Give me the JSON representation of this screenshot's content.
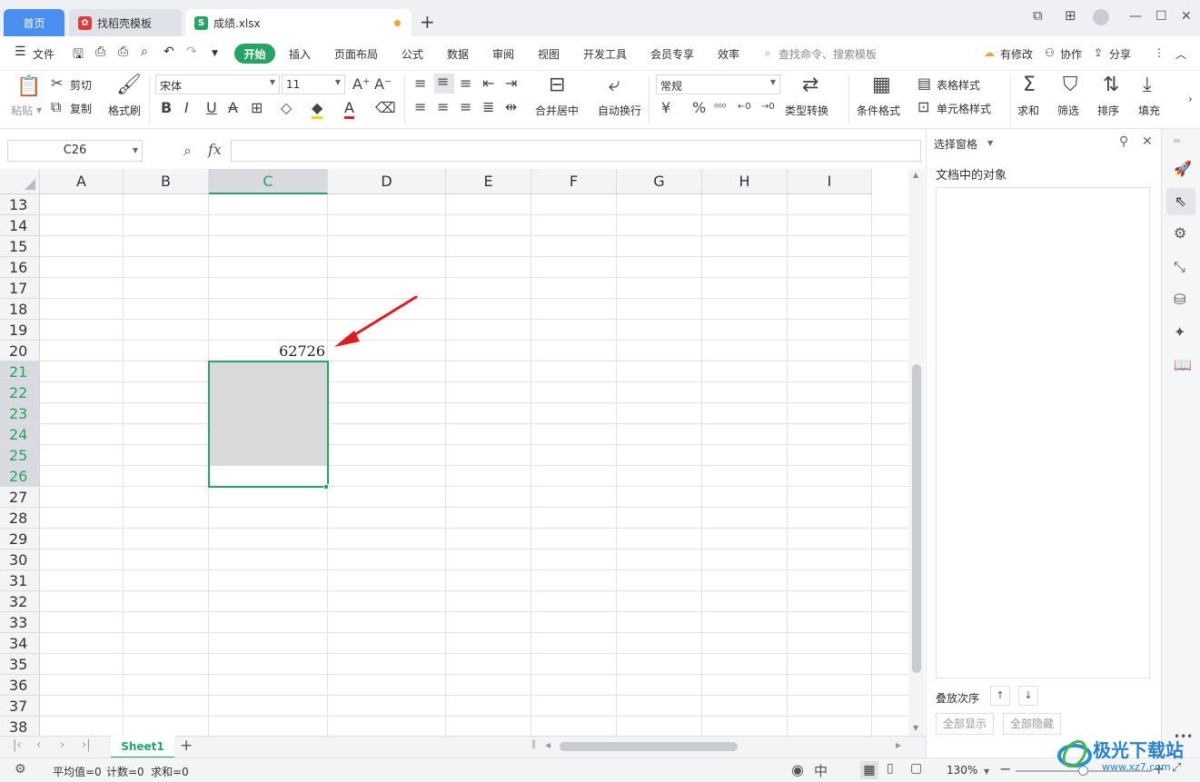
{
  "titlebar": {
    "tab_home": "首页",
    "tab_template": "找稻壳模板",
    "tab_file": "成绩.xlsx",
    "new_tab": "+"
  },
  "menu": {
    "file": "文件",
    "items": [
      "开始",
      "插入",
      "页面布局",
      "公式",
      "数据",
      "审阅",
      "视图",
      "开发工具",
      "会员专享",
      "效率"
    ],
    "search_placeholder": "查找命令、搜索模板",
    "modified": "有修改",
    "collaborate": "协作",
    "share": "分享"
  },
  "ribbon": {
    "paste": "粘贴",
    "cut": "剪切",
    "copy": "复制",
    "format_painter": "格式刷",
    "font_name": "宋体",
    "font_size": "11",
    "merge_center": "合并居中",
    "auto_wrap": "自动换行",
    "number_format": "常规",
    "type_convert": "类型转换",
    "conditional_format": "条件格式",
    "table_style": "表格样式",
    "cell_style": "单元格样式",
    "sum": "求和",
    "filter": "筛选",
    "sort": "排序",
    "fill": "填充"
  },
  "formula_bar": {
    "name_box": "C26",
    "fx": "fx",
    "formula": ""
  },
  "grid": {
    "columns": [
      "A",
      "B",
      "C",
      "D",
      "E",
      "F",
      "G",
      "H",
      "I"
    ],
    "selected_column": "C",
    "rows": [
      "13",
      "14",
      "15",
      "16",
      "17",
      "18",
      "19",
      "20",
      "21",
      "22",
      "23",
      "24",
      "25",
      "26",
      "27",
      "28",
      "29",
      "30",
      "31",
      "32",
      "33",
      "34",
      "35",
      "36",
      "37",
      "38"
    ],
    "selected_rows": [
      "21",
      "22",
      "23",
      "24",
      "25",
      "26"
    ],
    "cell_c20": "62726"
  },
  "panel": {
    "title": "选择窗格",
    "subtitle": "文档中的对象",
    "stack_order": "叠放次序",
    "show_all": "全部显示",
    "hide_all": "全部隐藏"
  },
  "sheets": {
    "active": "Sheet1"
  },
  "status": {
    "average": "平均值=0",
    "count": "计数=0",
    "sum": "求和=0",
    "zoom": "130%"
  },
  "watermark": {
    "text": "极光下载站",
    "url": "www.xz7.com"
  },
  "colors": {
    "accent_green": "#27a465",
    "home_tab_blue": "#4a8ff0",
    "arrow_red": "#e02020"
  }
}
